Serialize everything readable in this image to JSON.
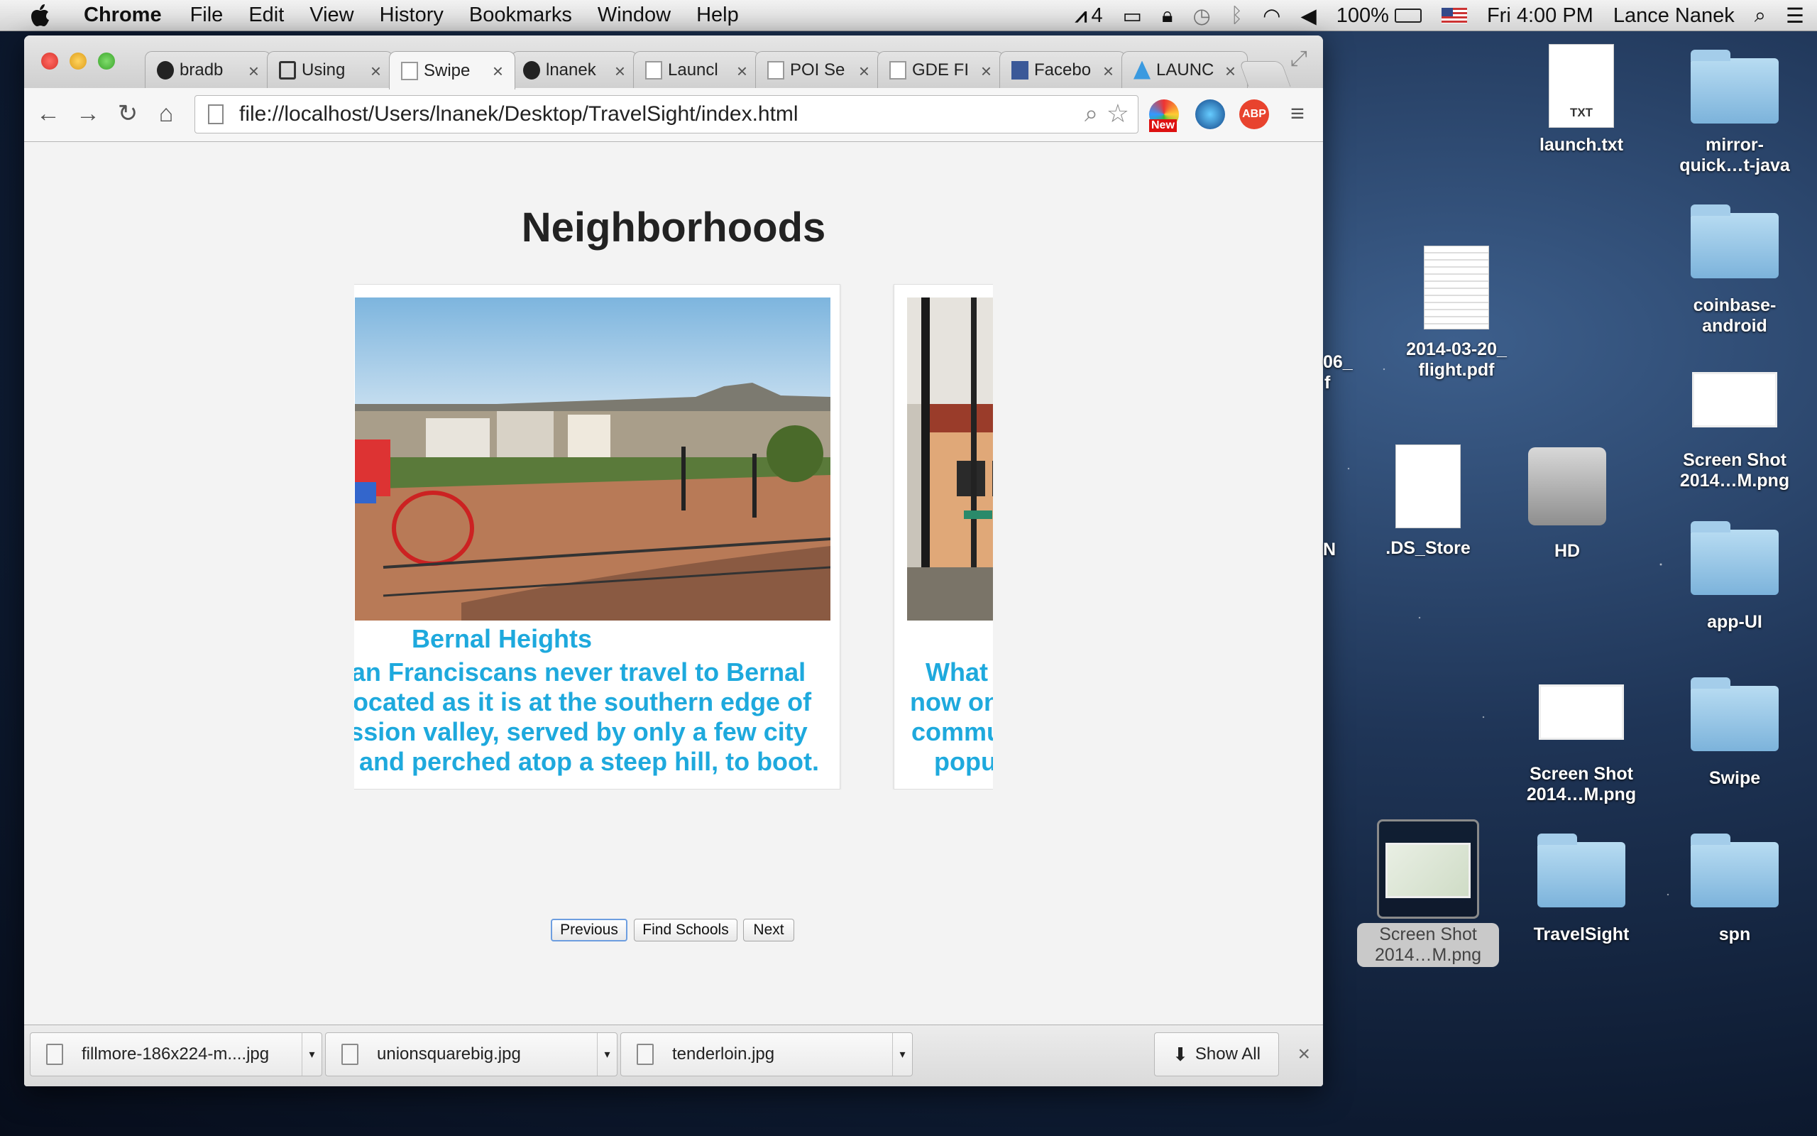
{
  "menubar": {
    "app": "Chrome",
    "items": [
      "File",
      "Edit",
      "View",
      "History",
      "Bookmarks",
      "Window",
      "Help"
    ],
    "status": {
      "notifications": "4",
      "battery": "100%",
      "clock": "Fri 4:00 PM",
      "user": "Lance Nanek"
    }
  },
  "browser": {
    "tabs": [
      {
        "label": "bradb",
        "icon": "github-icon"
      },
      {
        "label": "Using",
        "icon": "page-icon"
      },
      {
        "label": "Swipe",
        "icon": "page-icon",
        "active": true
      },
      {
        "label": "lnanek",
        "icon": "github-icon"
      },
      {
        "label": "Launcl",
        "icon": "page-icon"
      },
      {
        "label": "POI Se",
        "icon": "page-icon"
      },
      {
        "label": "GDE FI",
        "icon": "page-icon"
      },
      {
        "label": "Facebo",
        "icon": "facebook-icon"
      },
      {
        "label": "LAUNC",
        "icon": "launch-icon"
      }
    ],
    "url": "file://localhost/Users/lnanek/Desktop/TravelSight/index.html",
    "new_badge": "New",
    "abp_label": "ABP"
  },
  "page": {
    "title": "Neighborhoods",
    "cards": [
      {
        "title": "Bernal Heights",
        "description": [
          "an Franciscans never travel to Bernal",
          "located as it is at the southern edge of",
          "ssion valley, served by only a few city",
          "s and perched atop a steep hill, to boot."
        ]
      },
      {
        "title": "",
        "description": [
          "What w",
          "now one",
          "commun",
          "popular"
        ]
      }
    ],
    "buttons": {
      "previous": "Previous",
      "find_schools": "Find Schools",
      "next": "Next"
    }
  },
  "downloads": {
    "items": [
      "fillmore-186x224-m....jpg",
      "unionsquarebig.jpg",
      "tenderloin.jpg"
    ],
    "show_all": "Show All"
  },
  "desktop": {
    "partial_labels": [
      "06_",
      "f",
      "N"
    ],
    "icons": [
      {
        "label": "launch.txt",
        "type": "txt",
        "badge": "TXT"
      },
      {
        "label": "mirror-\nquick…t-java",
        "type": "folder"
      },
      {
        "label": "2014-03-20_\nflight.pdf",
        "type": "pdf"
      },
      {
        "label": "coinbase-\nandroid",
        "type": "folder"
      },
      {
        "label": ".DS_Store",
        "type": "doc"
      },
      {
        "label": "HD",
        "type": "disk"
      },
      {
        "label": "Screen Shot\n2014…M.png",
        "type": "screenshot"
      },
      {
        "label": "app-UI",
        "type": "folder"
      },
      {
        "label": "Screen Shot\n2014…M.png",
        "type": "screenshot"
      },
      {
        "label": "Swipe",
        "type": "folder"
      },
      {
        "label": "Screen Shot\n2014…M.png",
        "type": "screenshot",
        "selected": true
      },
      {
        "label": "TravelSight",
        "type": "folder"
      },
      {
        "label": "spn",
        "type": "folder"
      }
    ]
  }
}
